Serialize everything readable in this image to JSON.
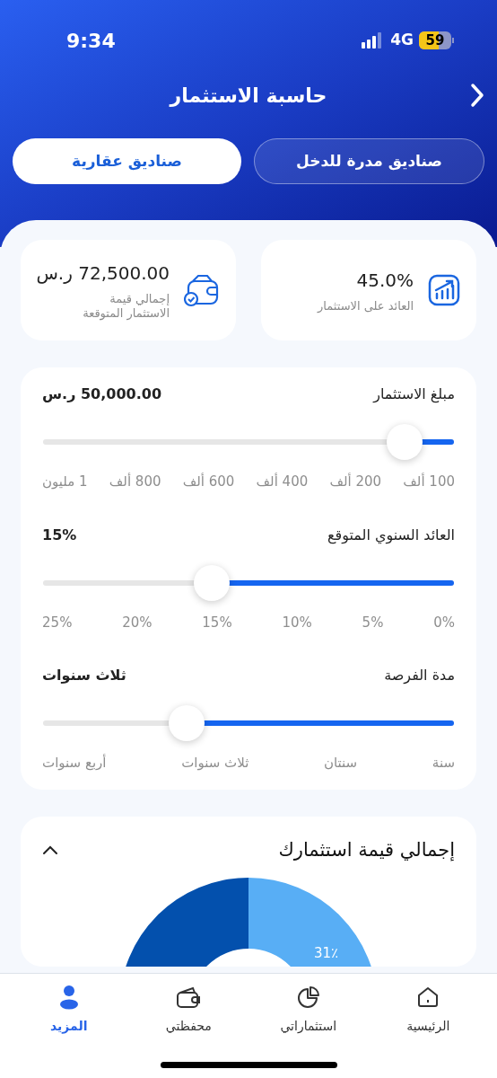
{
  "status_bar": {
    "time": "9:34",
    "network": "4G",
    "battery": "59"
  },
  "header": {
    "title": "حاسبة الاستثمار"
  },
  "tabs": [
    {
      "label": "صناديق مدرة للدخل",
      "selected": false
    },
    {
      "label": "صناديق عقارية",
      "selected": true
    }
  ],
  "stats": [
    {
      "kind": "growth",
      "value": "45.0%",
      "label": "العائد على الاستثمار"
    },
    {
      "kind": "wallet",
      "value": "72,500.00 ر.س",
      "label": "إجمالي قيمة\nالاستثمار المتوقعة"
    }
  ],
  "sliders": [
    {
      "label": "مبلغ الاستثمار",
      "value": "50,000.00 ر.س",
      "level": 0.12,
      "ticks": [
        "100 ألف",
        "200 ألف",
        "400 ألف",
        "600 ألف",
        "800 ألف",
        "1 مليون"
      ]
    },
    {
      "label": "العائد السنوي المتوقع",
      "value": "15%",
      "level": 0.59,
      "ticks": [
        "0%",
        "5%",
        "10%",
        "15%",
        "20%",
        "25%"
      ]
    },
    {
      "label": "مدة الفرصة",
      "value": "ثلاث سنوات",
      "level": 0.65,
      "ticks": [
        "سنة",
        "سنتان",
        "ثلاث سنوات",
        "أربع سنوات"
      ]
    }
  ],
  "summary": {
    "title": "إجمالي قيمة استثمارك",
    "expanded": true,
    "slice_label": "31٪"
  },
  "nav": [
    {
      "kind": "home",
      "label": "الرئيسية",
      "selected": false
    },
    {
      "kind": "investments",
      "label": "استثماراتي",
      "selected": false
    },
    {
      "kind": "wallet",
      "label": "محفظتي",
      "selected": false
    },
    {
      "kind": "more",
      "label": "المزيد",
      "selected": true
    }
  ]
}
